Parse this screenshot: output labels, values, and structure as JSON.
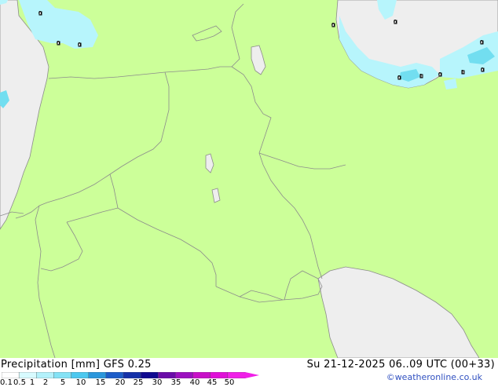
{
  "map": {
    "title": "Precipitation [mm]",
    "model": "GFS 0.25",
    "valid_time": "Su 21-12-2025 06..09 UTC (00+33)",
    "credit": "©weatheronline.co.uk",
    "colors": {
      "land": "#ccff99",
      "sea": "#eeeeee",
      "border": "#8c8c8c",
      "precip_light": "#b7f5fc",
      "precip_medium": "#72def0",
      "precip_heavy": "#40c4ec"
    },
    "place_labels": [
      "0",
      "0",
      "0",
      "0",
      "0",
      "0",
      "1",
      "0",
      "1",
      "0",
      "0"
    ]
  },
  "legend": {
    "ticks": [
      "0.1",
      "0.5",
      "1",
      "2",
      "5",
      "10",
      "15",
      "20",
      "25",
      "30",
      "35",
      "40",
      "45",
      "50"
    ],
    "colors": [
      "#ffffff",
      "#d8fbff",
      "#b3f1fb",
      "#84e2f5",
      "#4cc8ef",
      "#2a96dc",
      "#1c5cc8",
      "#1430a8",
      "#100a90",
      "#6a0ca8",
      "#9c10c0",
      "#c810c8",
      "#e010d8",
      "#f020e8"
    ]
  }
}
